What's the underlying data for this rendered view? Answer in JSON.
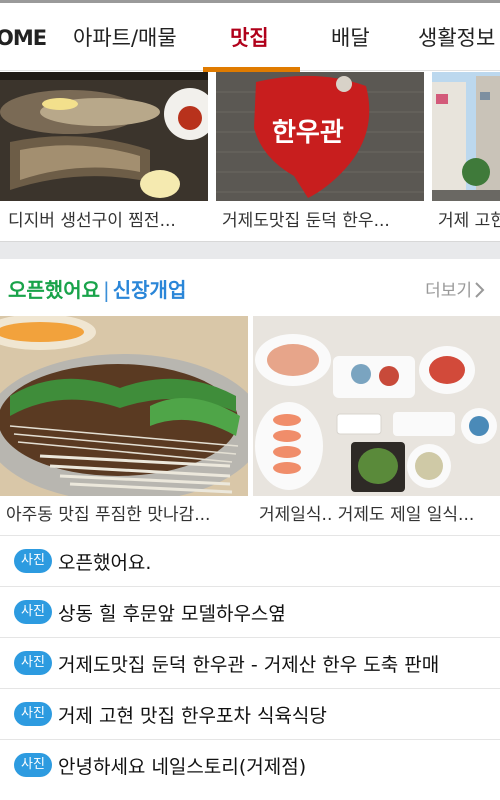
{
  "tabs": {
    "home": "OME",
    "apartment": "아파트/매물",
    "restaurants": "맛집",
    "delivery": "배달",
    "life_info": "생활정보"
  },
  "top_cards": [
    {
      "caption": "디지버 생선구이 찜전..."
    },
    {
      "caption": "거제도맛집 둔덕 한우..."
    },
    {
      "caption": "거제 고현"
    }
  ],
  "sign_text": "한우관",
  "section": {
    "title_green": "오픈했어요",
    "divider": "|",
    "title_blue": "신장개업",
    "more": "더보기"
  },
  "grid_cards": [
    {
      "caption": "아주동 맛집 푸짐한 맛나감..."
    },
    {
      "caption": "거제일식.. 거제도 제일 일식..."
    }
  ],
  "list": {
    "badge": "사진",
    "items": [
      "오픈했어요.",
      "상동 힐 후문앞 모델하우스옆",
      "거제도맛집 둔덕 한우관 - 거제산 한우 도축 판매",
      "거제 고현 맛집 한우포차 식육식당",
      "안녕하세요 네일스토리(거제점)"
    ]
  },
  "colors": {
    "active_tab": "#b0001a",
    "tab_underline": "#e07b00",
    "section_green": "#19a34a",
    "section_blue": "#2a86d8",
    "badge": "#2d9be0"
  }
}
